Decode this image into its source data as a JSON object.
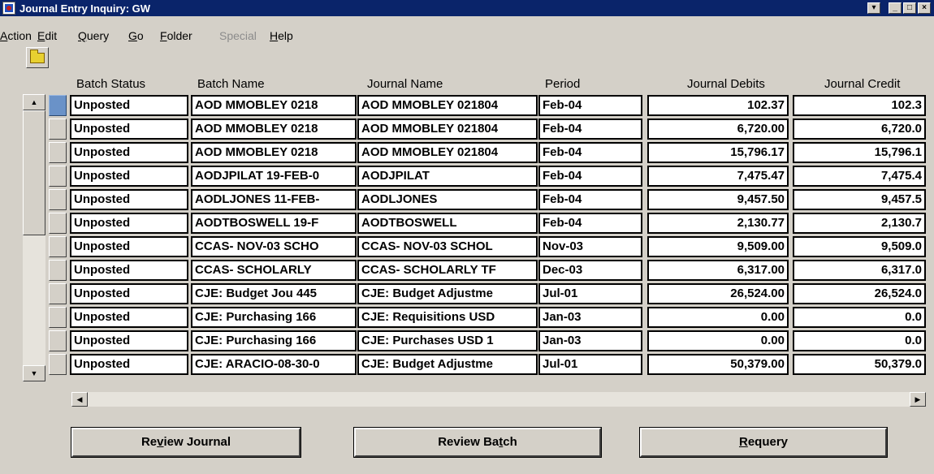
{
  "window": {
    "title": "Journal Entry Inquiry: GW"
  },
  "menu": [
    {
      "pre": "",
      "key": "A",
      "post": "ction",
      "disabled": false
    },
    {
      "pre": "",
      "key": "E",
      "post": "dit",
      "disabled": false
    },
    {
      "pre": "",
      "key": "Q",
      "post": "uery",
      "disabled": false
    },
    {
      "pre": "",
      "key": "G",
      "post": "o",
      "disabled": false
    },
    {
      "pre": "",
      "key": "F",
      "post": "older",
      "disabled": false
    },
    {
      "pre": "Special",
      "key": "",
      "post": "",
      "disabled": true
    },
    {
      "pre": "",
      "key": "H",
      "post": "elp",
      "disabled": false
    }
  ],
  "toolbar": {
    "open_icon": "folder-open-icon"
  },
  "columns": [
    "Batch Status",
    "Batch Name",
    "Journal Name",
    "Period",
    "Journal Debits",
    "Journal Credit"
  ],
  "rows": [
    {
      "status": "Unposted",
      "batch": "AOD MMOBLEY 0218",
      "journal": "AOD MMOBLEY 021804",
      "period": "Feb-04",
      "debits": "102.37",
      "credits": "102.3"
    },
    {
      "status": "Unposted",
      "batch": "AOD MMOBLEY 0218",
      "journal": "AOD MMOBLEY 021804",
      "period": "Feb-04",
      "debits": "6,720.00",
      "credits": "6,720.0"
    },
    {
      "status": "Unposted",
      "batch": "AOD MMOBLEY 0218",
      "journal": "AOD MMOBLEY 021804",
      "period": "Feb-04",
      "debits": "15,796.17",
      "credits": "15,796.1"
    },
    {
      "status": "Unposted",
      "batch": "AODJPILAT 19-FEB-0",
      "journal": "AODJPILAT",
      "period": "Feb-04",
      "debits": "7,475.47",
      "credits": "7,475.4"
    },
    {
      "status": "Unposted",
      "batch": "AODLJONES 11-FEB-",
      "journal": "AODLJONES",
      "period": "Feb-04",
      "debits": "9,457.50",
      "credits": "9,457.5"
    },
    {
      "status": "Unposted",
      "batch": "AODTBOSWELL 19-F",
      "journal": "AODTBOSWELL",
      "period": "Feb-04",
      "debits": "2,130.77",
      "credits": "2,130.7"
    },
    {
      "status": "Unposted",
      "batch": "CCAS- NOV-03 SCHO",
      "journal": "CCAS- NOV-03 SCHOL",
      "period": "Nov-03",
      "debits": "9,509.00",
      "credits": "9,509.0"
    },
    {
      "status": "Unposted",
      "batch": "CCAS- SCHOLARLY",
      "journal": "CCAS- SCHOLARLY TF",
      "period": "Dec-03",
      "debits": "6,317.00",
      "credits": "6,317.0"
    },
    {
      "status": "Unposted",
      "batch": "CJE:  Budget Jou 445",
      "journal": "CJE: Budget Adjustme",
      "period": "Jul-01",
      "debits": "26,524.00",
      "credits": "26,524.0"
    },
    {
      "status": "Unposted",
      "batch": "CJE:  Purchasing 166",
      "journal": "CJE: Requisitions USD",
      "period": "Jan-03",
      "debits": "0.00",
      "credits": "0.0"
    },
    {
      "status": "Unposted",
      "batch": "CJE:  Purchasing 166",
      "journal": "CJE: Purchases USD  1",
      "period": "Jan-03",
      "debits": "0.00",
      "credits": "0.0"
    },
    {
      "status": "Unposted",
      "batch": "CJE: ARACIO-08-30-0",
      "journal": "CJE: Budget Adjustme",
      "period": "Jul-01",
      "debits": "50,379.00",
      "credits": "50,379.0"
    }
  ],
  "buttons": {
    "review_journal": {
      "pre": "Re",
      "key": "v",
      "post": "iew Journal"
    },
    "review_batch": {
      "pre": "Review Ba",
      "key": "t",
      "post": "ch"
    },
    "requery": {
      "pre": "",
      "key": "R",
      "post": "equery"
    }
  },
  "colors": {
    "titlebar": "#0a246a",
    "background": "#d4d0c8",
    "selected_row_indicator": "#6a92c8"
  }
}
